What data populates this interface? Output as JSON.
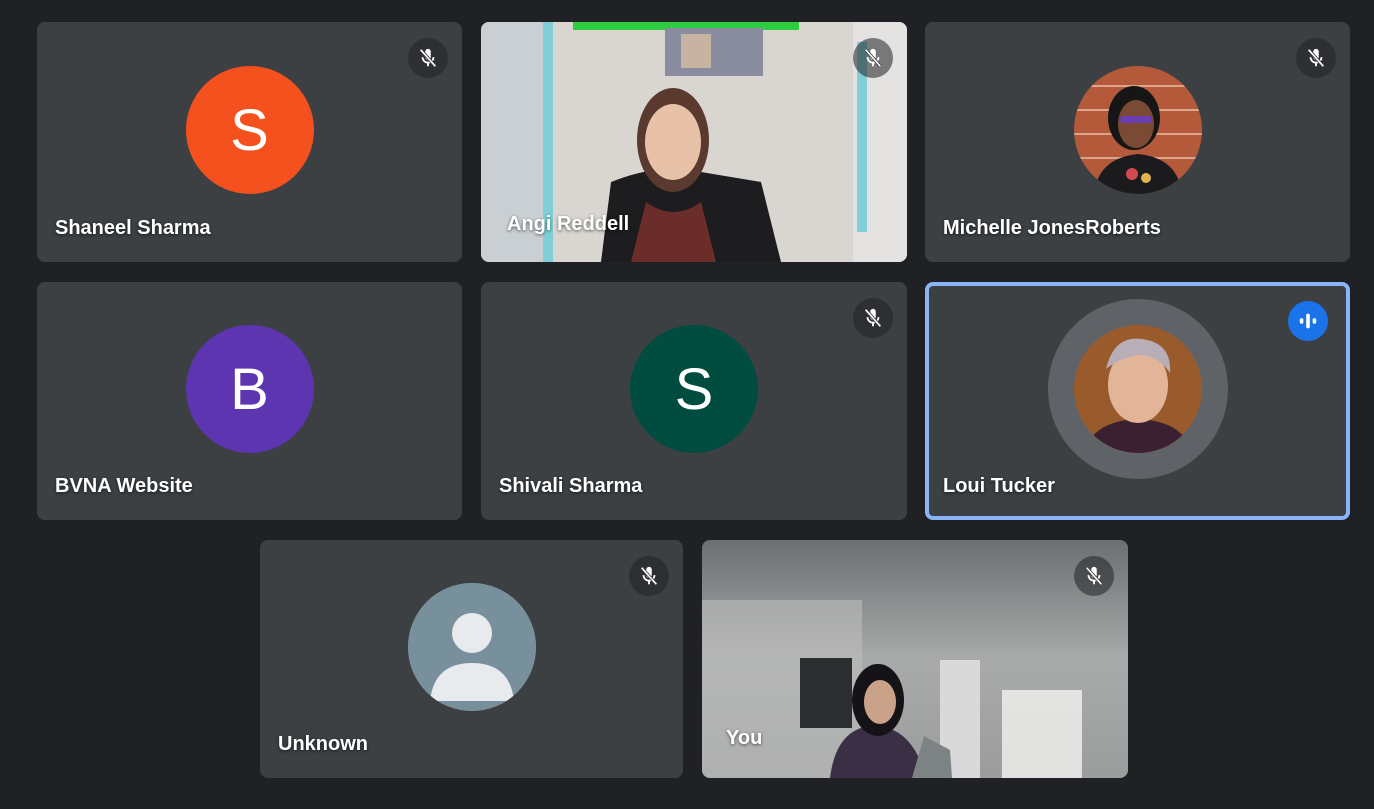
{
  "participants": [
    {
      "name": "Shaneel Sharma",
      "initial": "S",
      "avatar_color": "#f4511e",
      "muted": true
    },
    {
      "name": "Angi Reddell",
      "video": true,
      "muted": true
    },
    {
      "name": "Michelle JonesRoberts",
      "photo": true,
      "muted": true
    },
    {
      "name": "BVNA Website",
      "initial": "B",
      "avatar_color": "#5e35b1",
      "muted": false
    },
    {
      "name": "Shivali Sharma",
      "initial": "S",
      "avatar_color": "#004d40",
      "muted": true
    },
    {
      "name": "Loui Tucker",
      "photo": true,
      "speaking": true
    },
    {
      "name": "Unknown",
      "avatar_color": "#78909c",
      "muted": true
    },
    {
      "name": "You",
      "video": true,
      "muted": true
    }
  ],
  "icons": {
    "mute": "mic-off-icon",
    "speaking": "audio-level-icon",
    "anonymous": "person-icon"
  },
  "colors": {
    "background": "#202124",
    "tile": "#3c4043",
    "speaking_border": "#8ab4f8",
    "speaking_badge": "#1a73e8"
  }
}
